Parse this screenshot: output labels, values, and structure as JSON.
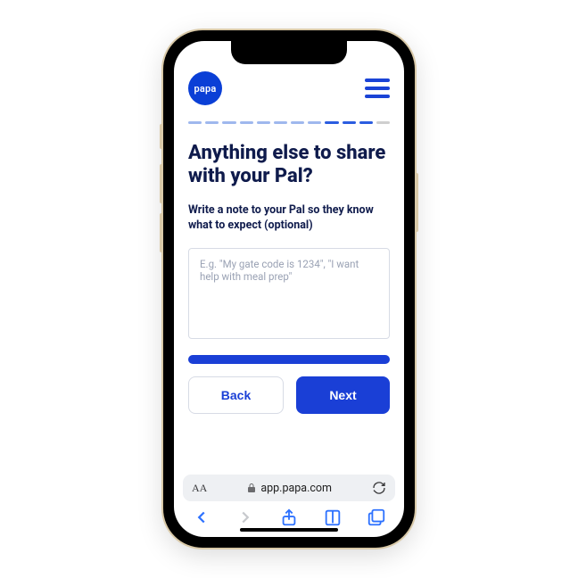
{
  "header": {
    "logo_text": "papa"
  },
  "page": {
    "title": "Anything else to share with your Pal?",
    "subtitle": "Write a note to your Pal so they know what to expect (optional)",
    "note_value": "",
    "note_placeholder": "E.g. \"My gate code is 1234\", \"I want help with meal prep\""
  },
  "nav": {
    "back_label": "Back",
    "next_label": "Next"
  },
  "browser": {
    "text_size_label": "AA",
    "url": "app.papa.com"
  }
}
